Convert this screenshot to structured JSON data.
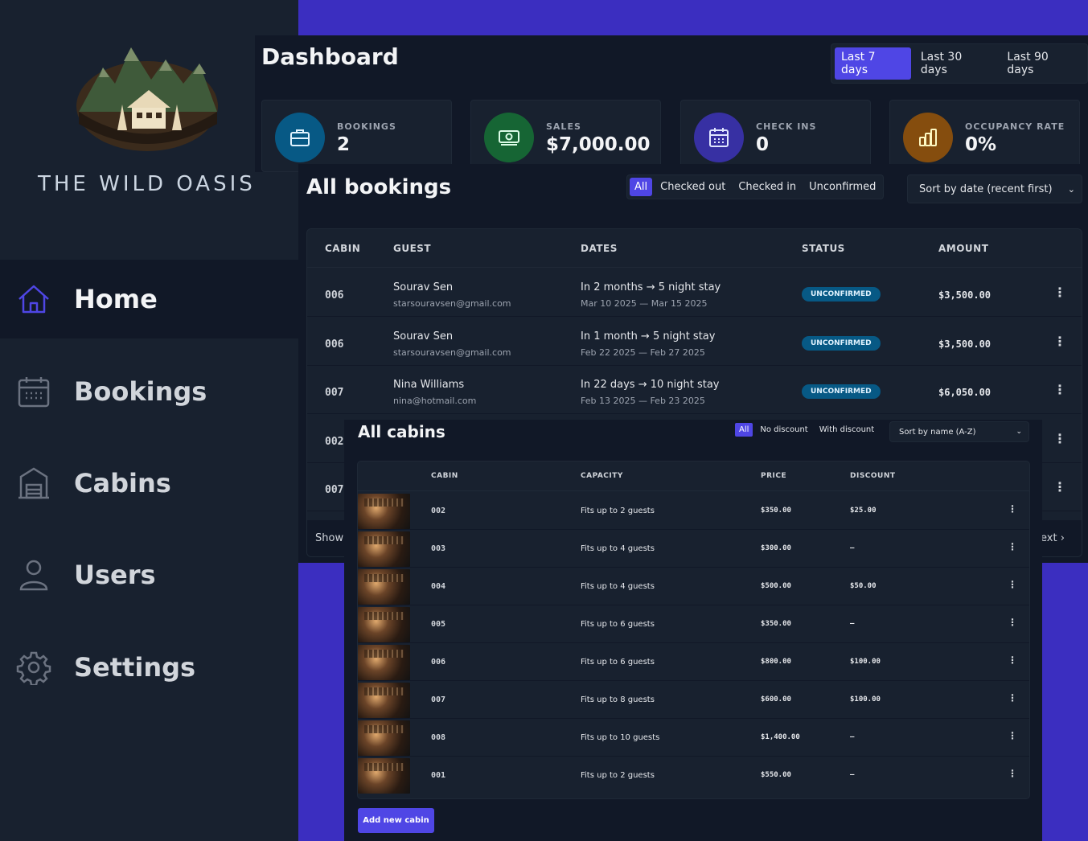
{
  "brand": {
    "name": "THE WILD OASIS"
  },
  "nav": [
    {
      "label": "Home",
      "icon": "home-icon",
      "active": true
    },
    {
      "label": "Bookings",
      "icon": "calendar-icon"
    },
    {
      "label": "Cabins",
      "icon": "warehouse-icon"
    },
    {
      "label": "Users",
      "icon": "user-icon"
    },
    {
      "label": "Settings",
      "icon": "gear-icon"
    }
  ],
  "dashboard": {
    "title": "Dashboard",
    "filters": [
      "Last 7 days",
      "Last 30 days",
      "Last 90 days"
    ],
    "active_filter": "Last 7 days",
    "stats": [
      {
        "label": "BOOKINGS",
        "value": "2",
        "icon": "briefcase-icon",
        "color": "#075985"
      },
      {
        "label": "SALES",
        "value": "$7,000.00",
        "icon": "banknotes-icon",
        "color": "#166534"
      },
      {
        "label": "CHECK INS",
        "value": "0",
        "icon": "calendar-days-icon",
        "color": "#3730a3"
      },
      {
        "label": "OCCUPANCY RATE",
        "value": "0%",
        "icon": "chart-bar-icon",
        "color": "#854d0e"
      }
    ]
  },
  "bookings": {
    "title": "All bookings",
    "filters": [
      "All",
      "Checked out",
      "Checked in",
      "Unconfirmed"
    ],
    "sort": "Sort by date (recent first)",
    "headers": [
      "CABIN",
      "GUEST",
      "DATES",
      "STATUS",
      "AMOUNT"
    ],
    "rows": [
      {
        "cabin": "006",
        "guest": "Sourav Sen",
        "email": "starsouravsen@gmail.com",
        "stay": "In 2 months → 5 night stay",
        "dates": "Mar 10 2025 — Mar 15 2025",
        "status": "UNCONFIRMED",
        "amount": "$3,500.00"
      },
      {
        "cabin": "006",
        "guest": "Sourav Sen",
        "email": "starsouravsen@gmail.com",
        "stay": "In 1 month → 5 night stay",
        "dates": "Feb 22 2025 — Feb 27 2025",
        "status": "UNCONFIRMED",
        "amount": "$3,500.00"
      },
      {
        "cabin": "007",
        "guest": "Nina Williams",
        "email": "nina@hotmail.com",
        "stay": "In 22 days → 10 night stay",
        "dates": "Feb 13 2025 — Feb 23 2025",
        "status": "UNCONFIRMED",
        "amount": "$6,050.00"
      },
      {
        "cabin": "002"
      },
      {
        "cabin": "007"
      }
    ],
    "footer_left": "Showi",
    "footer_right": "ext"
  },
  "cabins": {
    "title": "All cabins",
    "filters": [
      "All",
      "No discount",
      "With discount"
    ],
    "sort": "Sort by name (A-Z)",
    "headers": [
      "CABIN",
      "CAPACITY",
      "PRICE",
      "DISCOUNT"
    ],
    "rows": [
      {
        "name": "002",
        "capacity": "Fits up to 2 guests",
        "price": "$350.00",
        "discount": "$25.00"
      },
      {
        "name": "003",
        "capacity": "Fits up to 4 guests",
        "price": "$300.00",
        "discount": "—"
      },
      {
        "name": "004",
        "capacity": "Fits up to 4 guests",
        "price": "$500.00",
        "discount": "$50.00"
      },
      {
        "name": "005",
        "capacity": "Fits up to 6 guests",
        "price": "$350.00",
        "discount": "—"
      },
      {
        "name": "006",
        "capacity": "Fits up to 6 guests",
        "price": "$800.00",
        "discount": "$100.00"
      },
      {
        "name": "007",
        "capacity": "Fits up to 8 guests",
        "price": "$600.00",
        "discount": "$100.00"
      },
      {
        "name": "008",
        "capacity": "Fits up to 10 guests",
        "price": "$1,400.00",
        "discount": "—"
      },
      {
        "name": "001",
        "capacity": "Fits up to 2 guests",
        "price": "$550.00",
        "discount": "—"
      }
    ],
    "add_button": "Add new cabin"
  },
  "colors": {
    "accent": "#4f46e5",
    "background": "#3b2ec0",
    "sidebar": "#18212f",
    "panel": "#111827"
  }
}
